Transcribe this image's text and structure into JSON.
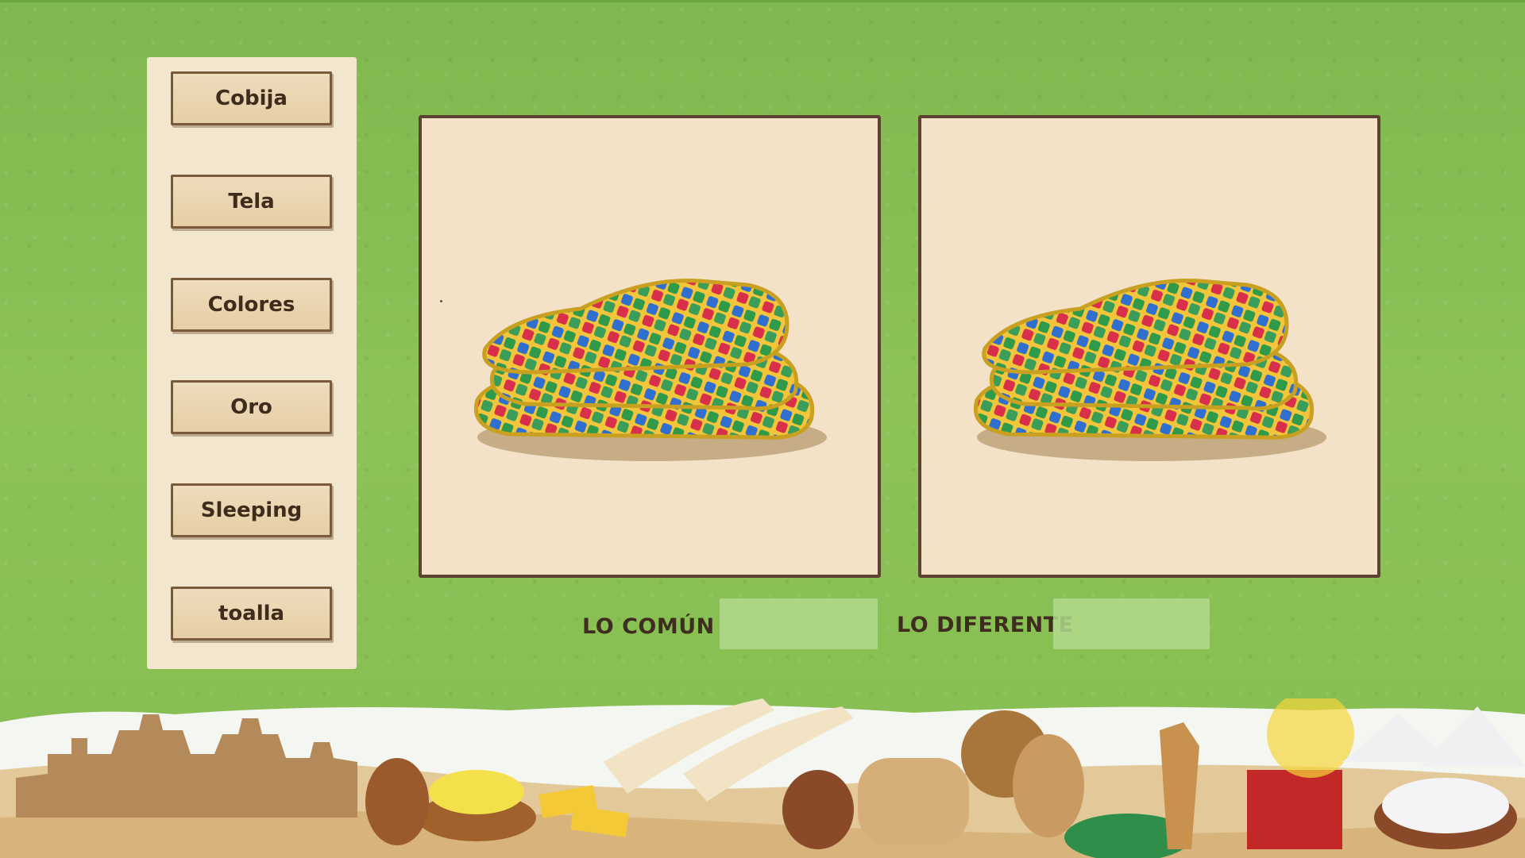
{
  "words": [
    {
      "label": "Cobija"
    },
    {
      "label": "Tela"
    },
    {
      "label": "Colores"
    },
    {
      "label": "Oro"
    },
    {
      "label": "Sleeping"
    },
    {
      "label": "toalla"
    }
  ],
  "answer_row": {
    "common_label": "LO COMÚN",
    "common_value": "",
    "different_label": "LO DIFERENTE",
    "different_value": ""
  },
  "images": {
    "left": "colorful-blanket-stack",
    "right": "colorful-blanket-stack"
  },
  "colors": {
    "background": "#86be52",
    "panel": "#f3e6cf",
    "card": "#e6cfa6",
    "card_border": "#7a5a3a",
    "frame_border": "#5c4230",
    "text": "#3f2e1f",
    "slot": "#b3d88d"
  }
}
